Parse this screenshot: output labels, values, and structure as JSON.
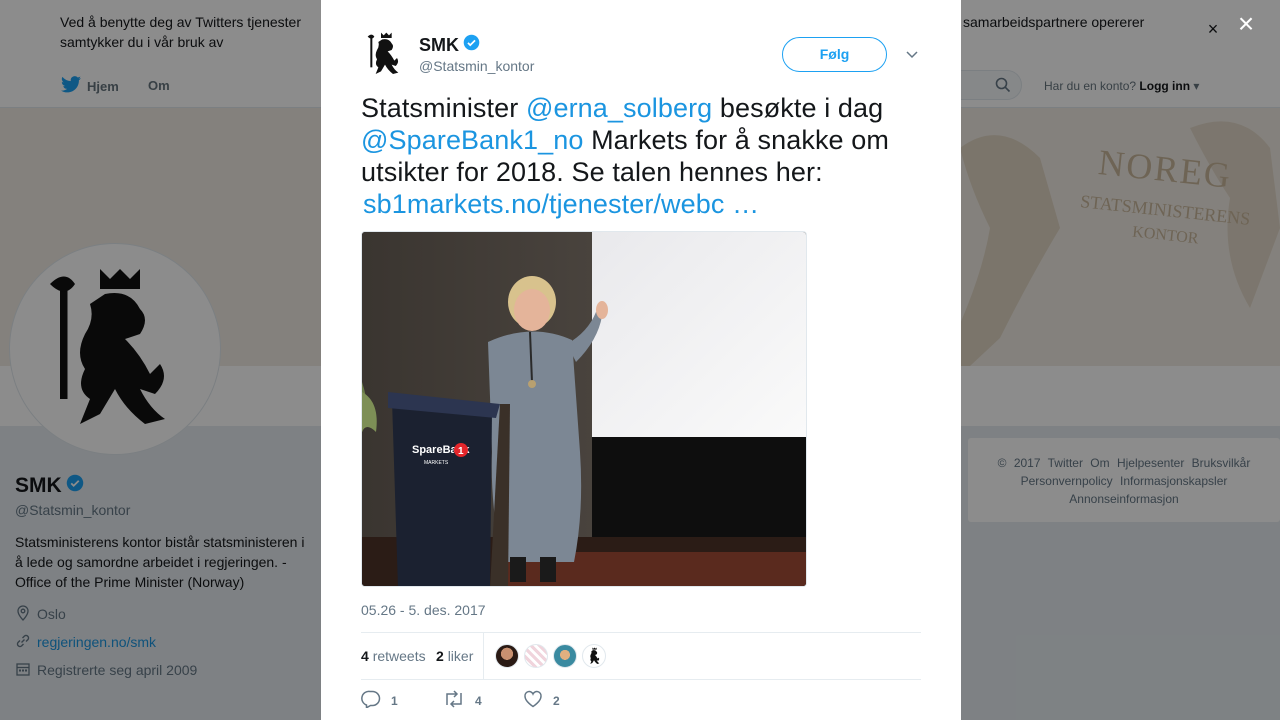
{
  "cookie_banner": {
    "text_left": "Ved å benytte deg av Twitters tjenester samtykker du i vår bruk av informasjonskapsler. globalt, og bruker informasjonskapsler til b",
    "text_right": "samarbeidspartnere opererer",
    "close_label": "×"
  },
  "nav": {
    "home": "Hjem",
    "about": "Om",
    "account_prompt": "Har du en konto?",
    "login": "Logg inn"
  },
  "banner": {
    "line1": "NOREG",
    "line2": "STATSMINISTERENS",
    "line3": "KONTOR"
  },
  "profile": {
    "name": "SMK",
    "handle": "@Statsmin_kontor",
    "bio": "Statsministerens kontor bistår statsministeren i å lede og samordne arbeidet i regjeringen. - Office of the Prime Minister (Norway)",
    "location": "Oslo",
    "website": "regjeringen.no/smk",
    "joined": "Registrerte seg april 2009"
  },
  "footer": {
    "line1": "© 2017 Twitter   Om   Hjelpesenter   Bruksvilkår",
    "line2": "Personvernpolicy   Informasjonskapsler",
    "line3": "Annonseinformasjon"
  },
  "modal_close": "×",
  "tweet": {
    "author_name": "SMK",
    "author_handle": "@Statsmin_kontor",
    "follow_label": "Følg",
    "text_1": "Statsminister ",
    "mention_1": "@erna_solberg",
    "text_2": " besøkte i dag ",
    "mention_2": "@SpareBank1_no",
    "text_3": " Markets for å snakke om utsikter for 2018. Se talen hennes her: ",
    "url": "sb1markets.no/tjenester/webc …",
    "podium_brand": "SpareBank",
    "podium_sub": "MARKETS",
    "podium_num": "1",
    "timestamp": "05.26 - 5. des. 2017",
    "retweets_count": "4",
    "retweets_label": "retweets",
    "likes_count": "2",
    "likes_label": "liker",
    "reply_count": "1",
    "retweet_action_count": "4",
    "like_action_count": "2"
  },
  "colors": {
    "link": "#1b95e0",
    "twitter_blue": "#1da1f2",
    "verified": "#1da1f2"
  }
}
